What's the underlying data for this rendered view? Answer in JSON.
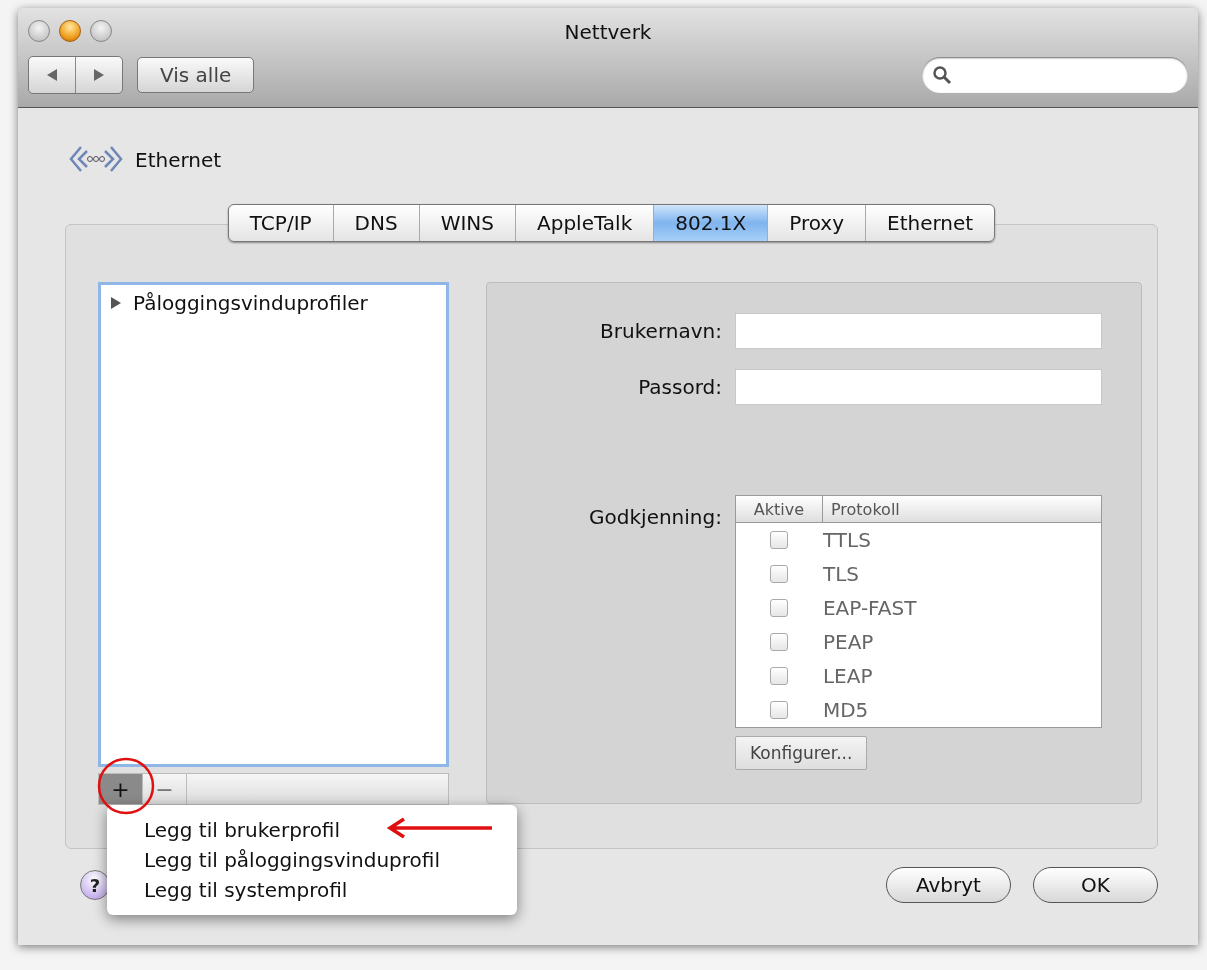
{
  "window": {
    "title": "Nettverk"
  },
  "toolbar": {
    "show_all": "Vis alle"
  },
  "header": {
    "title": "Ethernet"
  },
  "tabs": [
    {
      "label": "TCP/IP",
      "selected": false
    },
    {
      "label": "DNS",
      "selected": false
    },
    {
      "label": "WINS",
      "selected": false
    },
    {
      "label": "AppleTalk",
      "selected": false
    },
    {
      "label": "802.1X",
      "selected": true
    },
    {
      "label": "Proxy",
      "selected": false
    },
    {
      "label": "Ethernet",
      "selected": false
    }
  ],
  "profiles": [
    {
      "label": "Påloggingsvinduprofiler",
      "expanded": false
    }
  ],
  "list_buttons": [
    {
      "label": "+",
      "pressed": true
    },
    {
      "label": "−",
      "pressed": false
    }
  ],
  "fields": [
    {
      "label": "Brukernavn:"
    },
    {
      "label": "Passord:"
    }
  ],
  "authentication": {
    "label": "Godkjenning:",
    "columns": [
      "Aktive",
      "Protokoll"
    ],
    "rows": [
      {
        "protocol": "TTLS",
        "checked": false
      },
      {
        "protocol": "TLS",
        "checked": false
      },
      {
        "protocol": "EAP-FAST",
        "checked": false
      },
      {
        "protocol": "PEAP",
        "checked": false
      },
      {
        "protocol": "LEAP",
        "checked": false
      },
      {
        "protocol": "MD5",
        "checked": false
      }
    ],
    "configure": "Konfigurer..."
  },
  "menu": [
    {
      "label": "Legg til brukerprofil"
    },
    {
      "label": "Legg til påloggingsvinduprofil"
    },
    {
      "label": "Legg til systemprofil"
    }
  ],
  "help": "?",
  "buttons": [
    {
      "label": "Avbryt",
      "default": false
    },
    {
      "label": "OK",
      "default": false
    }
  ]
}
